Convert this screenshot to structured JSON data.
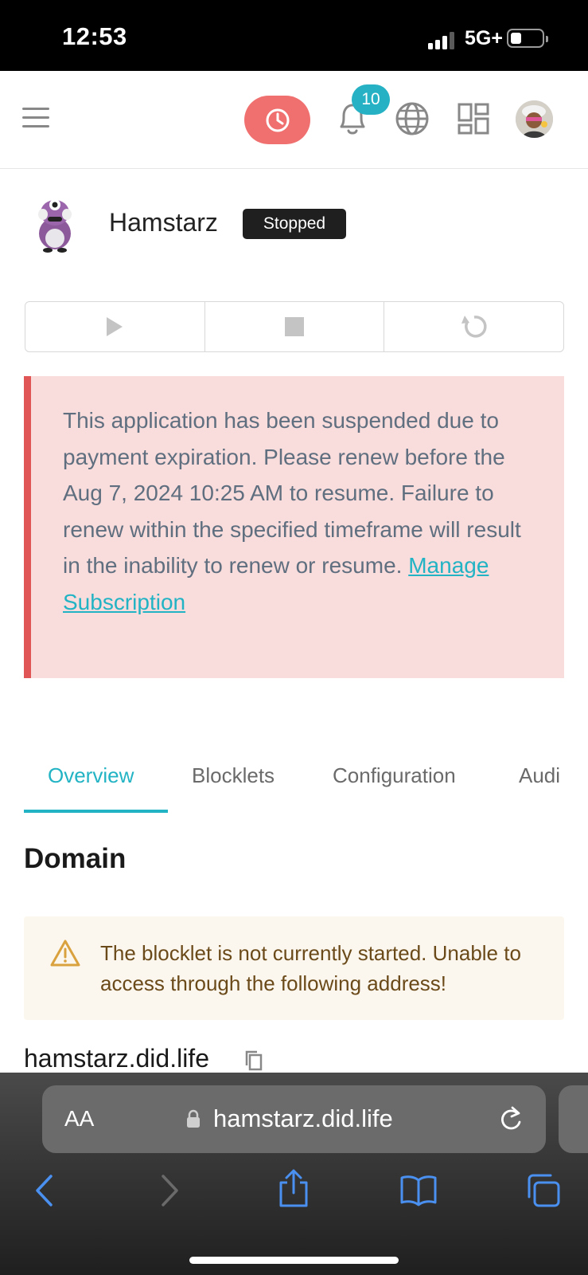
{
  "status_bar": {
    "time": "12:53",
    "network": "5G+"
  },
  "header": {
    "notification_count": "10",
    "icons": [
      "menu-icon",
      "clock-icon",
      "bell-icon",
      "globe-icon",
      "apps-grid-icon",
      "avatar"
    ]
  },
  "app": {
    "name": "Hamstarz",
    "status": "Stopped"
  },
  "controls": {
    "icons": [
      "play-icon",
      "stop-icon",
      "restart-icon"
    ]
  },
  "alert": {
    "message": "This application has been suspended due to payment expiration. Please renew before the Aug 7, 2024 10:25 AM to resume. Failure to renew within the specified timeframe will result in the inability to renew or resume.",
    "link_label": "Manage Subscription"
  },
  "tabs": [
    {
      "label": "Overview",
      "active": true
    },
    {
      "label": "Blocklets",
      "active": false
    },
    {
      "label": "Configuration",
      "active": false
    },
    {
      "label": "Audi",
      "active": false
    }
  ],
  "domain": {
    "title": "Domain",
    "warning": "The blocklet is not currently started. Unable to access through the following address!",
    "address": "hamstarz.did.life"
  },
  "browser": {
    "text_size_label": "AA",
    "url": "hamstarz.did.life",
    "toolbar_icons": [
      "back-icon",
      "forward-icon",
      "share-icon",
      "bookmarks-icon",
      "tabs-icon"
    ]
  },
  "colors": {
    "accent": "#22b3c4",
    "danger": "#e05555",
    "alert_bg": "#f9dcdc",
    "warning_bg": "#fcf7ee",
    "clock_button": "#f07070"
  }
}
